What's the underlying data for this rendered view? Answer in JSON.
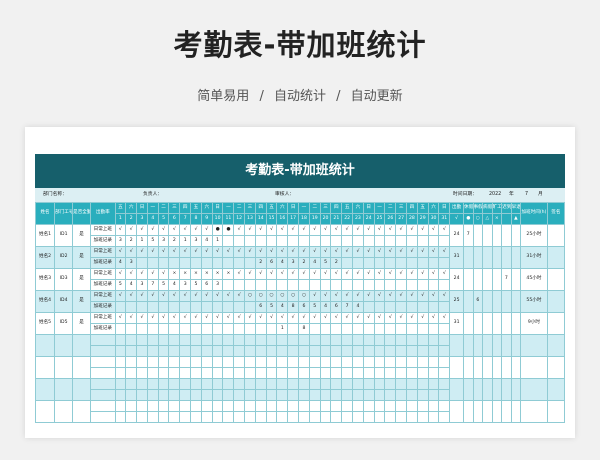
{
  "page": {
    "title": "考勤表-带加班统计",
    "subtitle_parts": [
      "简单易用",
      "/",
      "自动统计",
      "/",
      "自动更新"
    ]
  },
  "sheet": {
    "banner": "考勤表-带加班统计",
    "info": {
      "dept_label": "部门名称：",
      "leader_label": "负责人：",
      "reviewer_label": "审核人：",
      "time_label": "时间日期：",
      "year": "2022",
      "year_unit": "年",
      "month": "7",
      "month_unit": "月"
    },
    "headers": {
      "name": "姓名",
      "id": "部门工号",
      "type": "是否全勤",
      "work": "出勤率",
      "weekday_row": [
        "五",
        "六",
        "日",
        "一",
        "二",
        "三",
        "四",
        "五",
        "六",
        "日",
        "一",
        "二",
        "三",
        "四",
        "五",
        "六",
        "日",
        "一",
        "二",
        "三",
        "四",
        "五",
        "六",
        "日",
        "一",
        "二",
        "三",
        "四",
        "五",
        "六",
        "日"
      ],
      "day_row": [
        "1",
        "2",
        "3",
        "4",
        "5",
        "6",
        "7",
        "8",
        "9",
        "10",
        "11",
        "12",
        "13",
        "14",
        "15",
        "16",
        "17",
        "18",
        "19",
        "20",
        "21",
        "22",
        "23",
        "24",
        "25",
        "26",
        "27",
        "28",
        "29",
        "30",
        "31"
      ],
      "stats": [
        "出勤",
        "休假",
        "事假",
        "病假",
        "旷工",
        "迟到",
        "早退"
      ],
      "stat_symbols": [
        "√",
        "●",
        "○",
        "△",
        "×",
        "",
        "▲"
      ],
      "overtime": "加班时间(h)",
      "sign": "签名"
    },
    "row_types": [
      "日常上班",
      "加班记录"
    ],
    "employees": [
      {
        "name": "姓名1",
        "id": "ID1",
        "full": "是",
        "attendance": [
          "√",
          "√",
          "√",
          "√",
          "√",
          "√",
          "√",
          "√",
          "√",
          "●",
          "●",
          "√",
          "√",
          "√",
          "√",
          "√",
          "√",
          "√",
          "√",
          "√",
          "√",
          "√",
          "√",
          "√",
          "√",
          "√",
          "√",
          "√",
          "√",
          "√",
          "√"
        ],
        "overtime_days": [
          "3",
          "2",
          "1",
          "5",
          "3",
          "2",
          "1",
          "3",
          "4",
          "1",
          "",
          "",
          "",
          "",
          "",
          "",
          "",
          "",
          "",
          "",
          "",
          "",
          "",
          "",
          "",
          "",
          "",
          "",
          "",
          "",
          ""
        ],
        "stats": [
          "24",
          "7",
          "",
          "",
          "",
          "",
          ""
        ],
        "overtime_total": "25小时"
      },
      {
        "name": "姓名2",
        "id": "ID2",
        "full": "是",
        "attendance": [
          "√",
          "√",
          "√",
          "√",
          "√",
          "√",
          "√",
          "√",
          "√",
          "√",
          "√",
          "√",
          "√",
          "√",
          "√",
          "√",
          "√",
          "√",
          "√",
          "√",
          "√",
          "√",
          "√",
          "√",
          "√",
          "√",
          "√",
          "√",
          "√",
          "√",
          "√"
        ],
        "overtime_days": [
          "4",
          "3",
          "",
          "",
          "",
          "",
          "",
          "",
          "",
          "",
          "",
          "",
          "",
          "2",
          "6",
          "4",
          "3",
          "2",
          "4",
          "5",
          "2",
          "",
          "",
          "",
          "",
          "",
          "",
          "",
          "",
          "",
          ""
        ],
        "stats": [
          "31",
          "",
          "",
          "",
          "",
          "",
          ""
        ],
        "overtime_total": "31小时"
      },
      {
        "name": "姓名3",
        "id": "ID3",
        "full": "是",
        "attendance": [
          "√",
          "√",
          "√",
          "√",
          "√",
          "×",
          "×",
          "×",
          "×",
          "×",
          "×",
          "√",
          "√",
          "√",
          "√",
          "√",
          "√",
          "√",
          "√",
          "√",
          "√",
          "√",
          "√",
          "√",
          "√",
          "√",
          "√",
          "√",
          "√",
          "√",
          "√"
        ],
        "overtime_days": [
          "5",
          "4",
          "3",
          "7",
          "5",
          "4",
          "3",
          "5",
          "6",
          "3",
          "",
          "",
          "",
          "",
          "",
          "",
          "",
          "",
          "",
          "",
          "",
          "",
          "",
          "",
          "",
          "",
          "",
          "",
          "",
          "",
          ""
        ],
        "stats": [
          "24",
          "",
          "",
          "",
          "",
          "7",
          ""
        ],
        "overtime_total": "45小时"
      },
      {
        "name": "姓名4",
        "id": "ID4",
        "full": "是",
        "attendance": [
          "√",
          "√",
          "√",
          "√",
          "√",
          "√",
          "√",
          "√",
          "√",
          "√",
          "√",
          "√",
          "○",
          "○",
          "○",
          "○",
          "○",
          "○",
          "√",
          "√",
          "√",
          "√",
          "√",
          "√",
          "√",
          "√",
          "√",
          "√",
          "√",
          "√",
          "√"
        ],
        "overtime_days": [
          "",
          "",
          "",
          "",
          "",
          "",
          "",
          "",
          "",
          "",
          "",
          "",
          "",
          "6",
          "5",
          "4",
          "8",
          "6",
          "5",
          "4",
          "6",
          "7",
          "4",
          "",
          "",
          "",
          "",
          "",
          "",
          "",
          ""
        ],
        "stats": [
          "25",
          "",
          "6",
          "",
          "",
          "",
          ""
        ],
        "overtime_total": "55小时"
      },
      {
        "name": "姓名5",
        "id": "ID5",
        "full": "是",
        "attendance": [
          "√",
          "√",
          "√",
          "√",
          "√",
          "√",
          "√",
          "√",
          "√",
          "√",
          "√",
          "√",
          "√",
          "√",
          "√",
          "√",
          "√",
          "√",
          "√",
          "√",
          "√",
          "√",
          "√",
          "√",
          "√",
          "√",
          "√",
          "√",
          "√",
          "√",
          "√"
        ],
        "overtime_days": [
          "",
          "",
          "",
          "",
          "",
          "",
          "",
          "",
          "",
          "",
          "",
          "",
          "",
          "",
          "",
          "1",
          "",
          "8",
          "",
          "",
          "",
          "",
          "",
          "",
          "",
          "",
          "",
          "",
          "",
          "",
          ""
        ],
        "stats": [
          "31",
          "",
          "",
          "",
          "",
          "",
          ""
        ],
        "overtime_total": "9小时"
      }
    ],
    "blank_rows": 8
  }
}
